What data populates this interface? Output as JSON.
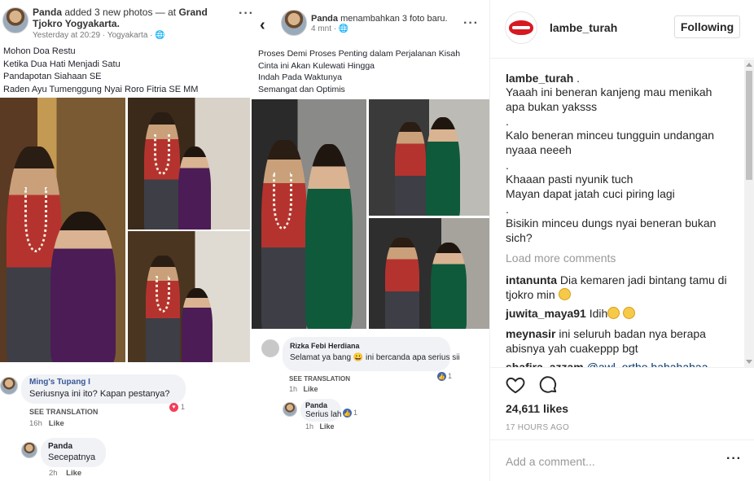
{
  "fb_left": {
    "name": "Panda",
    "action": " added 3 new photos — at ",
    "place": "Grand Tjokro Yogyakarta.",
    "time": "Yesterday at 20:29 · Yogyakarta · ",
    "caption": [
      "Mohon Doa Restu",
      "Ketika Dua Hati Menjadi Satu",
      "Pandapotan Siahaan SE",
      "Raden Ayu Tumenggung Nyai Roro Fitria SE MM"
    ],
    "comment1": {
      "name": "Ming's Tupang I",
      "text": "Seriusnya ini ito?  Kapan pestanya?",
      "see_translation": "SEE TRANSLATION",
      "time": "16h",
      "like": "Like",
      "reactions": "1"
    },
    "comment2": {
      "name": "Panda",
      "text": "Secepatnya",
      "time": "2h",
      "like": "Like"
    }
  },
  "fb_right": {
    "name": "Panda",
    "action": " menambahkan 3 foto baru.",
    "time": "4 mnt · ",
    "caption": [
      "Proses Demi Proses Penting dalam Perjalanan Kisah",
      "Cinta ini Akan Kulewati Hingga",
      "Indah Pada Waktunya",
      "Semangat dan Optimis"
    ],
    "comment1": {
      "name": "Rizka Febi Herdiana",
      "text": "Selamat ya bang 😀 ini bercanda apa serius sii",
      "see_translation": "SEE TRANSLATION",
      "time": "1h",
      "like": "Like",
      "reactions": "1"
    },
    "comment2": {
      "name": "Panda",
      "text": "Serius lah",
      "reactions": "1",
      "time": "1h",
      "like": "Like"
    }
  },
  "ig": {
    "username": "lambe_turah",
    "follow_label": "Following",
    "caption_user": "lambe_turah",
    "caption_lines": [
      ".",
      "Yaaah ini beneran kanjeng mau menikah",
      "apa bukan yaksss",
      ".",
      "Kalo beneran minceu tungguin undangan",
      "nyaaa neeeh",
      ".",
      "Khaaan pasti nyunik tuch",
      "Mayan dapat jatah cuci piring lagi",
      ".",
      "Bisikin minceu dungs nyai beneran bukan",
      "sich?"
    ],
    "load_more": "Load more comments",
    "comments": [
      {
        "user": "intanunta",
        "text": "Dia kemaren jadi bintang tamu di",
        "text2": "tjokro min"
      },
      {
        "user": "juwita_maya91",
        "text": "Idih"
      },
      {
        "user": "meynasir",
        "text": "ini seluruh badan nya berapa",
        "text2": "abisnya yah cuakeppp bgt"
      },
      {
        "user": "shafira_azzam",
        "text": "@awl_ortho hahahahaa"
      }
    ],
    "likes": "24,611 likes",
    "date": "17 HOURS AGO",
    "add_comment_placeholder": "Add a comment...",
    "icons": {
      "heart": "heart-icon",
      "comment": "comment-icon",
      "more": "more-options-icon"
    }
  }
}
